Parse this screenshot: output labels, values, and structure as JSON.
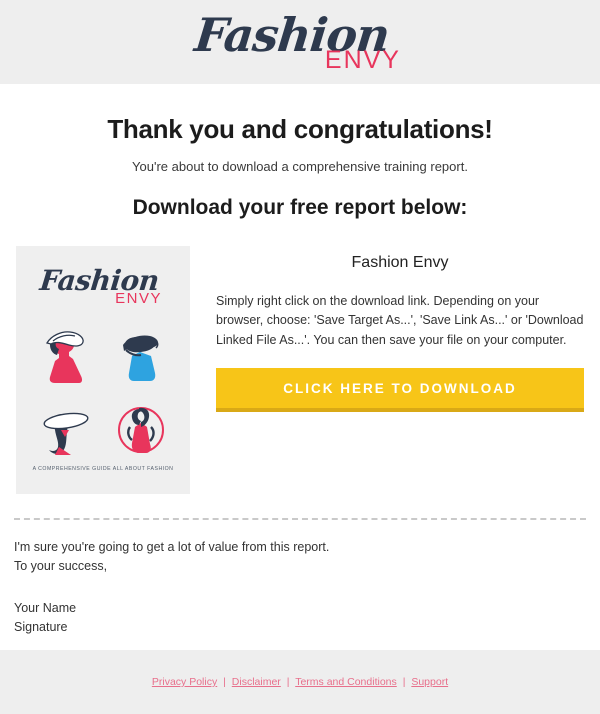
{
  "header": {
    "logo_script": "Fashion",
    "logo_sub": "ENVY",
    "brand_dark": "#2e3a4e",
    "brand_pink": "#e8355c",
    "band_color": "#eeeeee"
  },
  "main": {
    "title": "Thank you and congratulations!",
    "subtitle": "You're about to download a comprehensive training report.",
    "section_title": "Download your free report below:"
  },
  "download": {
    "product_name": "Fashion Envy",
    "instructions": "Simply right click on the download link. Depending on your browser, choose: 'Save Target As...', 'Save Link As...' or 'Download Linked File As...'. You can then save your file on your computer.",
    "button_label": "CLICK HERE TO DOWNLOAD",
    "button_color": "#f7c518",
    "button_shadow_color": "#d9a916",
    "cover": {
      "logo_script": "Fashion",
      "logo_sub": "ENVY",
      "tagline": "A COMPREHENSIVE GUIDE ALL ABOUT FASHION",
      "background": "#efefef",
      "illustrations": [
        {
          "name": "woman-red-dress-hat",
          "dress_color": "#e8355c",
          "hair_color": "#2e3a4e"
        },
        {
          "name": "woman-blue-dress-hat",
          "dress_color": "#2ea3e0",
          "hair_color": "#2e3a4e"
        },
        {
          "name": "woman-wide-brim-hat",
          "dress_color": "#e8355c",
          "hair_color": "#2e3a4e"
        },
        {
          "name": "woman-red-dress-circle",
          "dress_color": "#e8355c",
          "hair_color": "#2e3a4e"
        }
      ]
    }
  },
  "closing": {
    "line1": "I'm sure you're going to get a lot of value from this report.",
    "line2": "To your success,",
    "name": "Your Name",
    "signature": "Signature"
  },
  "footer": {
    "links": [
      {
        "label": "Privacy Policy"
      },
      {
        "label": "Disclaimer"
      },
      {
        "label": "Terms and Conditions"
      },
      {
        "label": "Support"
      }
    ],
    "separator": "|",
    "link_color": "#e8708c",
    "band_color": "#eeeeee"
  }
}
